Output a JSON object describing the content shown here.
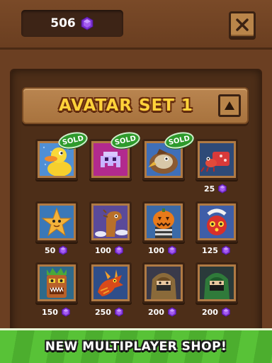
{
  "header": {
    "gem_count": "506"
  },
  "section": {
    "title": "AVATAR SET 1"
  },
  "banner": {
    "text": "NEW MULTIPLAYER SHOP!"
  },
  "sold_label": "SOLD",
  "colors": {
    "gem": "#8a3fd6",
    "sold_badge": "#2e9a2c",
    "title": "#ffd23a",
    "banner": "#58c237"
  },
  "avatars": [
    {
      "name": "duck",
      "status": "SOLD",
      "price": ""
    },
    {
      "name": "space-invader",
      "status": "SOLD",
      "price": ""
    },
    {
      "name": "eagle",
      "status": "SOLD",
      "price": ""
    },
    {
      "name": "hermit-crab",
      "status": "",
      "price": "25"
    },
    {
      "name": "starfish",
      "status": "",
      "price": "50"
    },
    {
      "name": "dinosaur",
      "status": "",
      "price": "100"
    },
    {
      "name": "pumpkin-bandit",
      "status": "",
      "price": "100"
    },
    {
      "name": "red-robot",
      "status": "",
      "price": "125"
    },
    {
      "name": "tiki-mask",
      "status": "",
      "price": "150"
    },
    {
      "name": "dragon",
      "status": "",
      "price": "250"
    },
    {
      "name": "brown-ninja",
      "status": "",
      "price": "200"
    },
    {
      "name": "green-ninja",
      "status": "",
      "price": "200"
    }
  ]
}
